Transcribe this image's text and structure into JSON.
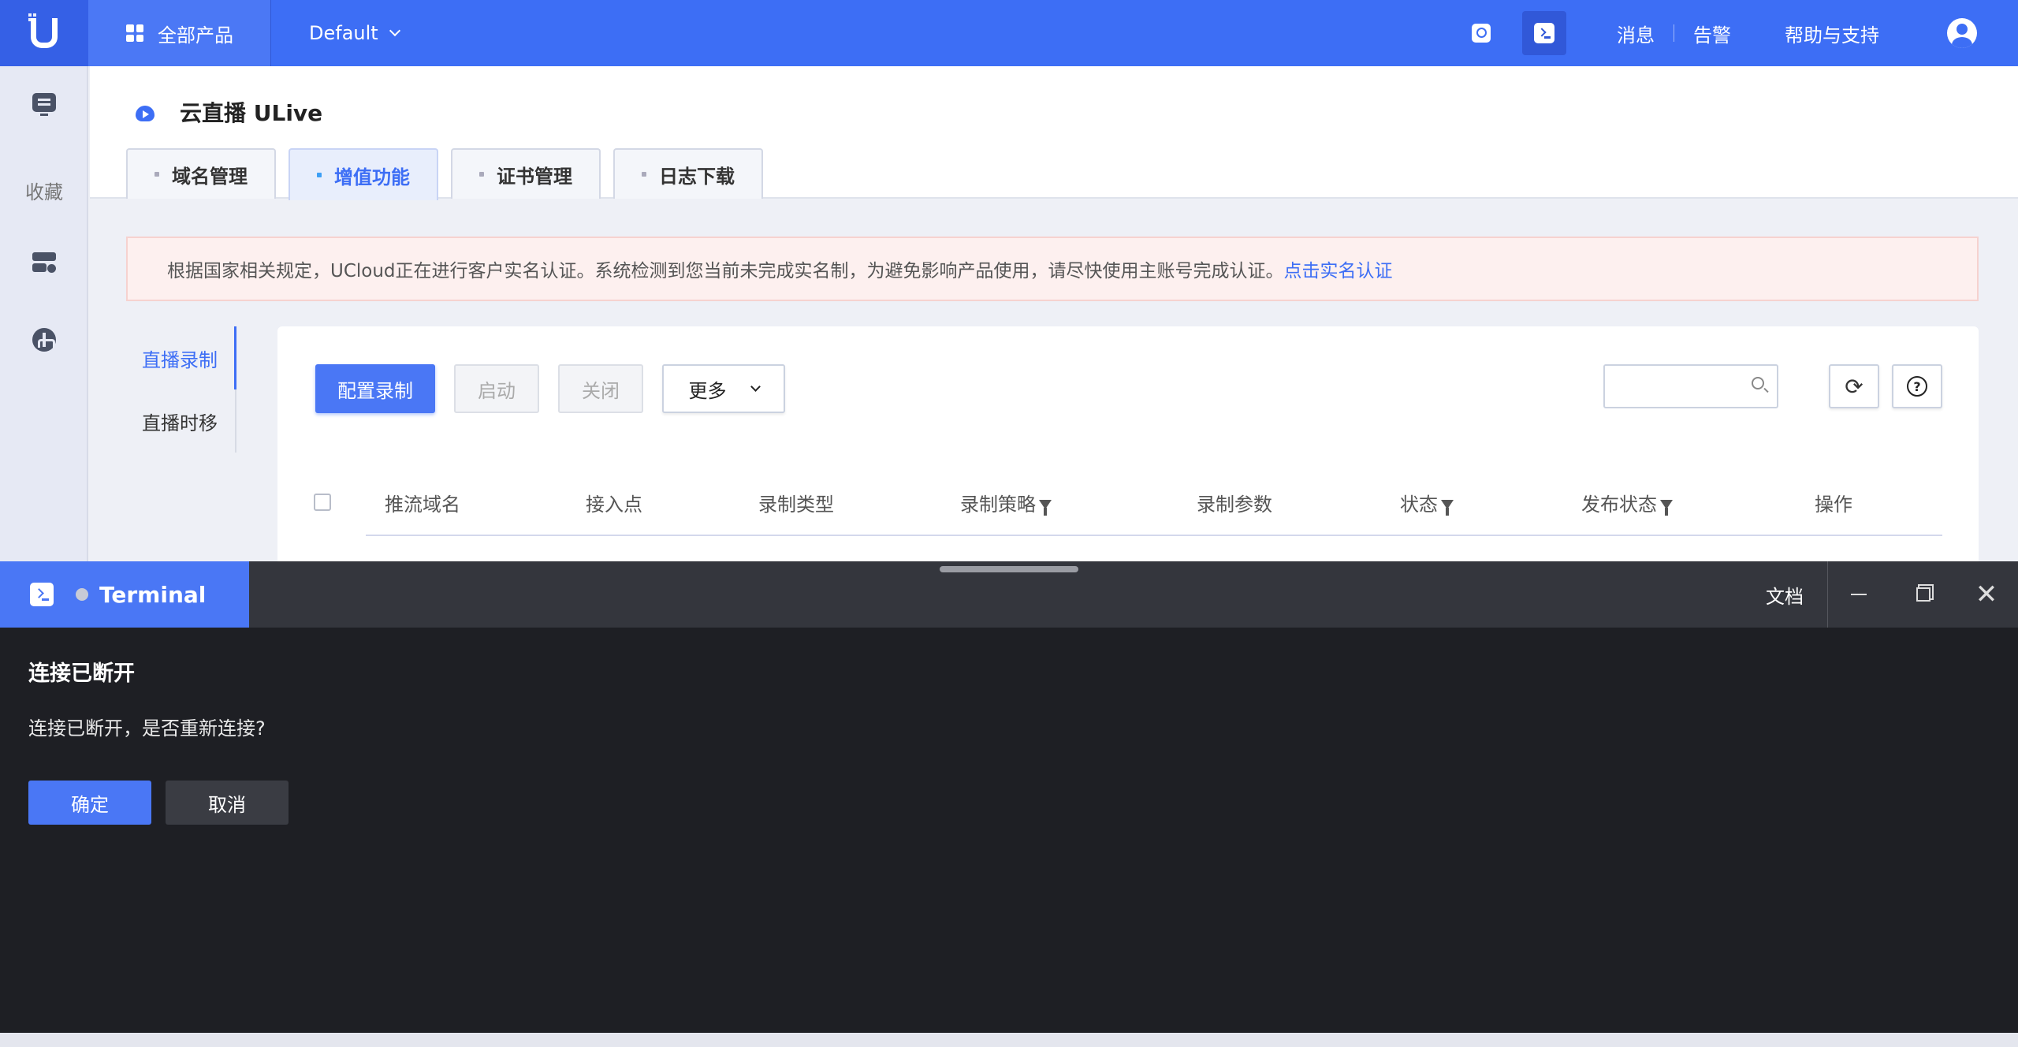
{
  "topbar": {
    "all_products": "全部产品",
    "project": "Default",
    "links": [
      "消息",
      "告警",
      "帮助与支持"
    ],
    "accent": "#3d6ef5"
  },
  "sidebar": {
    "favorites": "收藏",
    "icons": [
      "monitor-icon",
      "server-icon",
      "network-icon"
    ]
  },
  "page": {
    "title": "云直播 ULive",
    "tabs": [
      {
        "label": "域名管理"
      },
      {
        "label": "增值功能",
        "active": true
      },
      {
        "label": "证书管理"
      },
      {
        "label": "日志下载"
      }
    ],
    "notice": {
      "text": "根据国家相关规定，UCloud正在进行客户实名认证。系统检测到您当前未完成实名制，为避免影响产品使用，请尽快使用主账号完成认证。",
      "link": "点击实名认证"
    },
    "subnav": [
      {
        "label": "直播录制",
        "active": true
      },
      {
        "label": "直播时移"
      }
    ],
    "toolbar": {
      "configure": "配置录制",
      "start": "启动",
      "stop": "关闭",
      "more": "更多",
      "search_placeholder": ""
    },
    "table": {
      "columns": [
        "推流域名",
        "接入点",
        "录制类型",
        "录制策略",
        "录制参数",
        "状态",
        "发布状态",
        "操作"
      ]
    }
  },
  "terminal": {
    "tab_label": "Terminal",
    "docs": "文档",
    "dialog": {
      "title": "连接已断开",
      "message": "连接已断开，是否重新连接?",
      "ok": "确定",
      "cancel": "取消"
    }
  }
}
